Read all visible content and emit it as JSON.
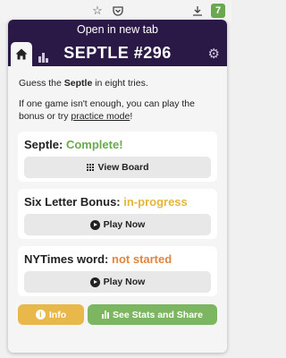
{
  "browser": {
    "icons": [
      "star-icon",
      "pocket-icon",
      "download-icon",
      "extension-icon"
    ],
    "extension_badge": "7"
  },
  "header": {
    "open_in_new_tab": "Open in new tab",
    "title": "SEPTLE #296",
    "accent": "#2a1947"
  },
  "intro": {
    "line1_prefix": "Guess the ",
    "line1_bold": "Septle",
    "line1_suffix": " in eight tries.",
    "line2_prefix": "If one game isn't enough, you can play the bonus or try ",
    "line2_link": "practice mode",
    "line2_suffix": "!"
  },
  "games": [
    {
      "label": "Septle:",
      "status": "Complete!",
      "button": "View Board",
      "status_color": "#6aaa4f"
    },
    {
      "label": "Six Letter Bonus:",
      "status": "in-progress",
      "button": "Play Now",
      "status_color": "#e4b63a"
    },
    {
      "label": "NYTimes word:",
      "status": "not started",
      "button": "Play Now",
      "status_color": "#e2853d"
    }
  ],
  "footer": {
    "info_label": "Info",
    "stats_label": "See Stats and Share"
  }
}
